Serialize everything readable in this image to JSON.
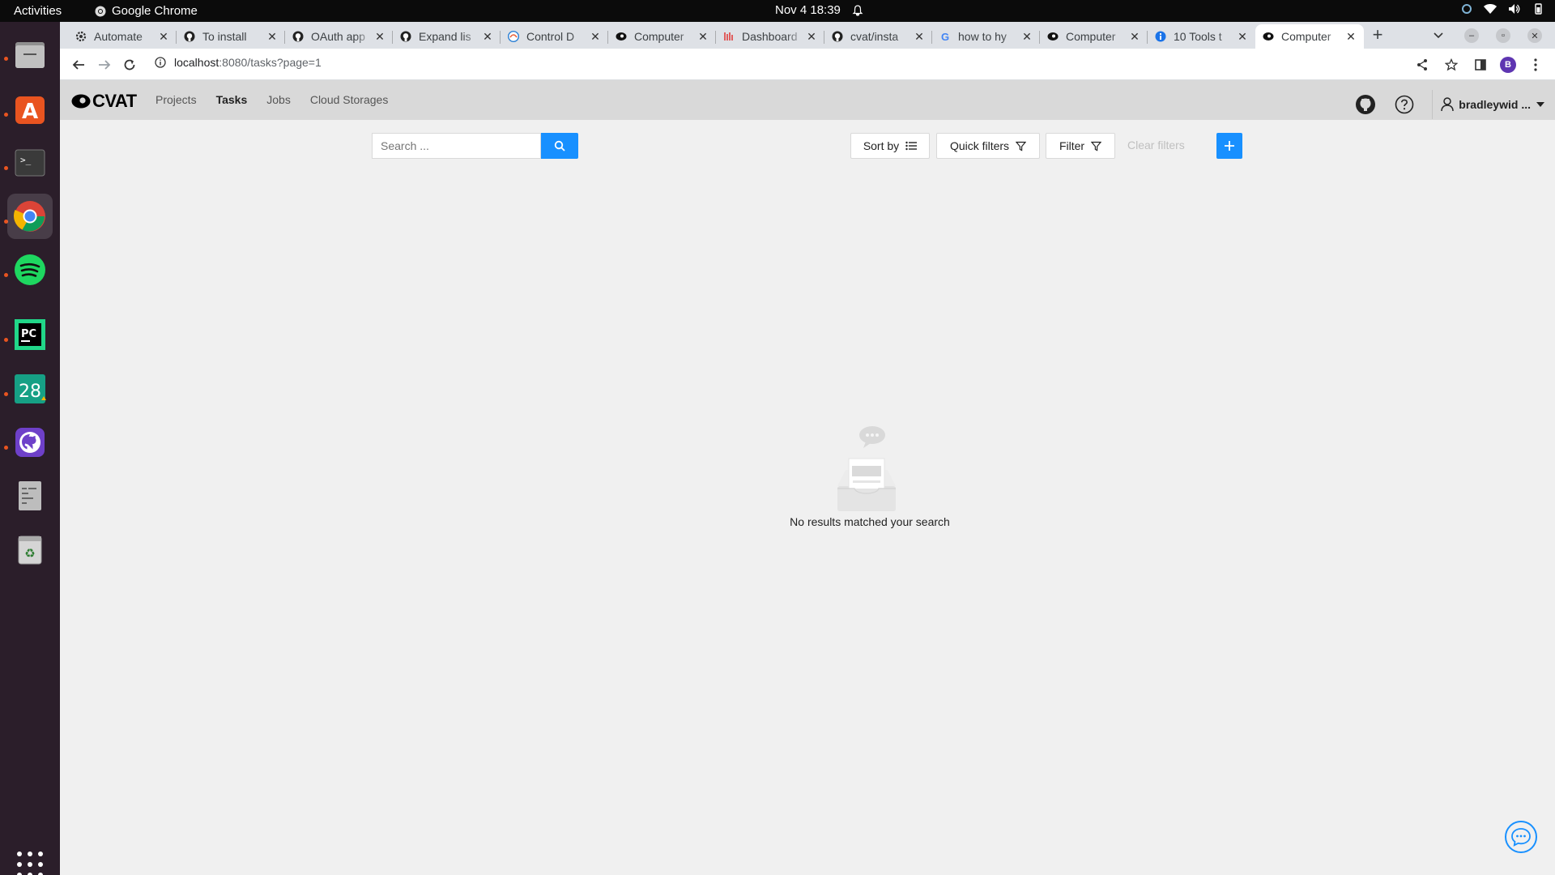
{
  "system": {
    "activities": "Activities",
    "app_name": "Google Chrome",
    "clock": "Nov 4  18:39"
  },
  "dock": {
    "items": [
      "files-icon",
      "ubuntu-software-icon",
      "terminal-icon",
      "chrome-icon",
      "spotify-icon",
      "pycharm-icon",
      "calendar-icon",
      "github-desktop-icon",
      "text-editor-icon",
      "trash-icon"
    ],
    "calendar_day": "28"
  },
  "browser": {
    "tabs": [
      {
        "label": "Automate",
        "icon": "gear-icon"
      },
      {
        "label": "To install",
        "icon": "github-icon"
      },
      {
        "label": "OAuth app",
        "icon": "github-icon"
      },
      {
        "label": "Expand lis",
        "icon": "github-icon"
      },
      {
        "label": "Control D",
        "icon": "edge-icon"
      },
      {
        "label": "Computer",
        "icon": "cvat-icon"
      },
      {
        "label": "Dashboard",
        "icon": "dashboard-icon"
      },
      {
        "label": "cvat/insta",
        "icon": "github-icon"
      },
      {
        "label": "how to hy",
        "icon": "google-icon"
      },
      {
        "label": "Computer",
        "icon": "cvat-icon"
      },
      {
        "label": "10 Tools t",
        "icon": "info-icon"
      },
      {
        "label": "Computer",
        "icon": "cvat-icon",
        "active": true
      }
    ],
    "url_host": "localhost",
    "url_path": ":8080/tasks?page=1",
    "profile_initial": "B"
  },
  "cvat": {
    "logo_text": "CVAT",
    "nav": [
      "Projects",
      "Tasks",
      "Jobs",
      "Cloud Storages"
    ],
    "active_nav": "Tasks",
    "username": "bradleywid ...",
    "search_placeholder": "Search ...",
    "sort_label": "Sort by",
    "quick_filters_label": "Quick filters",
    "filter_label": "Filter",
    "clear_filters_label": "Clear filters",
    "empty_message": "No results matched your search",
    "accent": "#1890ff"
  }
}
